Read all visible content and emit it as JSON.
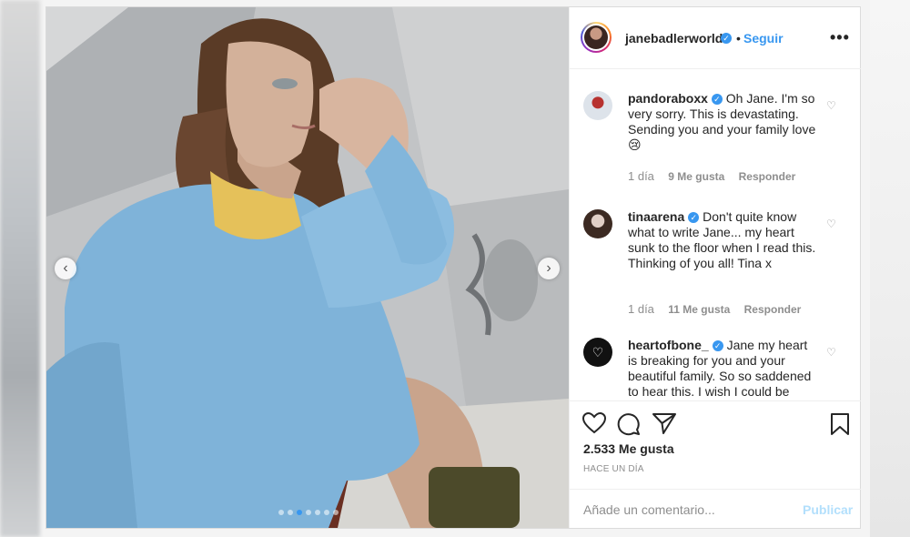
{
  "post": {
    "author": {
      "username": "janebadlerworld",
      "verified_icon": "verified-badge-icon",
      "separator": "•",
      "follow_label": "Seguir"
    },
    "more_options_label": "•••",
    "media": {
      "prev_arrow": "‹",
      "next_arrow": "›",
      "carousel_count": 7,
      "carousel_active_index": 2
    },
    "comments": [
      {
        "username": "pandoraboxx",
        "verified": true,
        "text": "Oh Jane. I'm so very sorry. This is devastating. Sending you and your family love",
        "emoji": "😢",
        "time": "1 día",
        "likes": "9 Me gusta",
        "reply": "Responder"
      },
      {
        "username": "tinaarena",
        "verified": true,
        "text": "Don't quite know what to write Jane... my heart sunk to the floor when I read this. Thinking of you all! Tina x",
        "time": "1 día",
        "likes": "11 Me gusta",
        "reply": "Responder"
      },
      {
        "username": "heartofbone_",
        "verified": true,
        "text": "Jane my heart is breaking for you and your beautiful family. So so saddened to hear this. I wish I could be"
      }
    ],
    "like_count": "2.533 Me gusta",
    "timestamp": "HACE UN DÍA",
    "comment_box": {
      "placeholder": "Añade un comentario...",
      "publish_label": "Publicar"
    }
  },
  "colors": {
    "accent": "#3897f0",
    "text": "#262626",
    "muted": "#8e8e8e",
    "publish_disabled": "#b2dffc"
  }
}
